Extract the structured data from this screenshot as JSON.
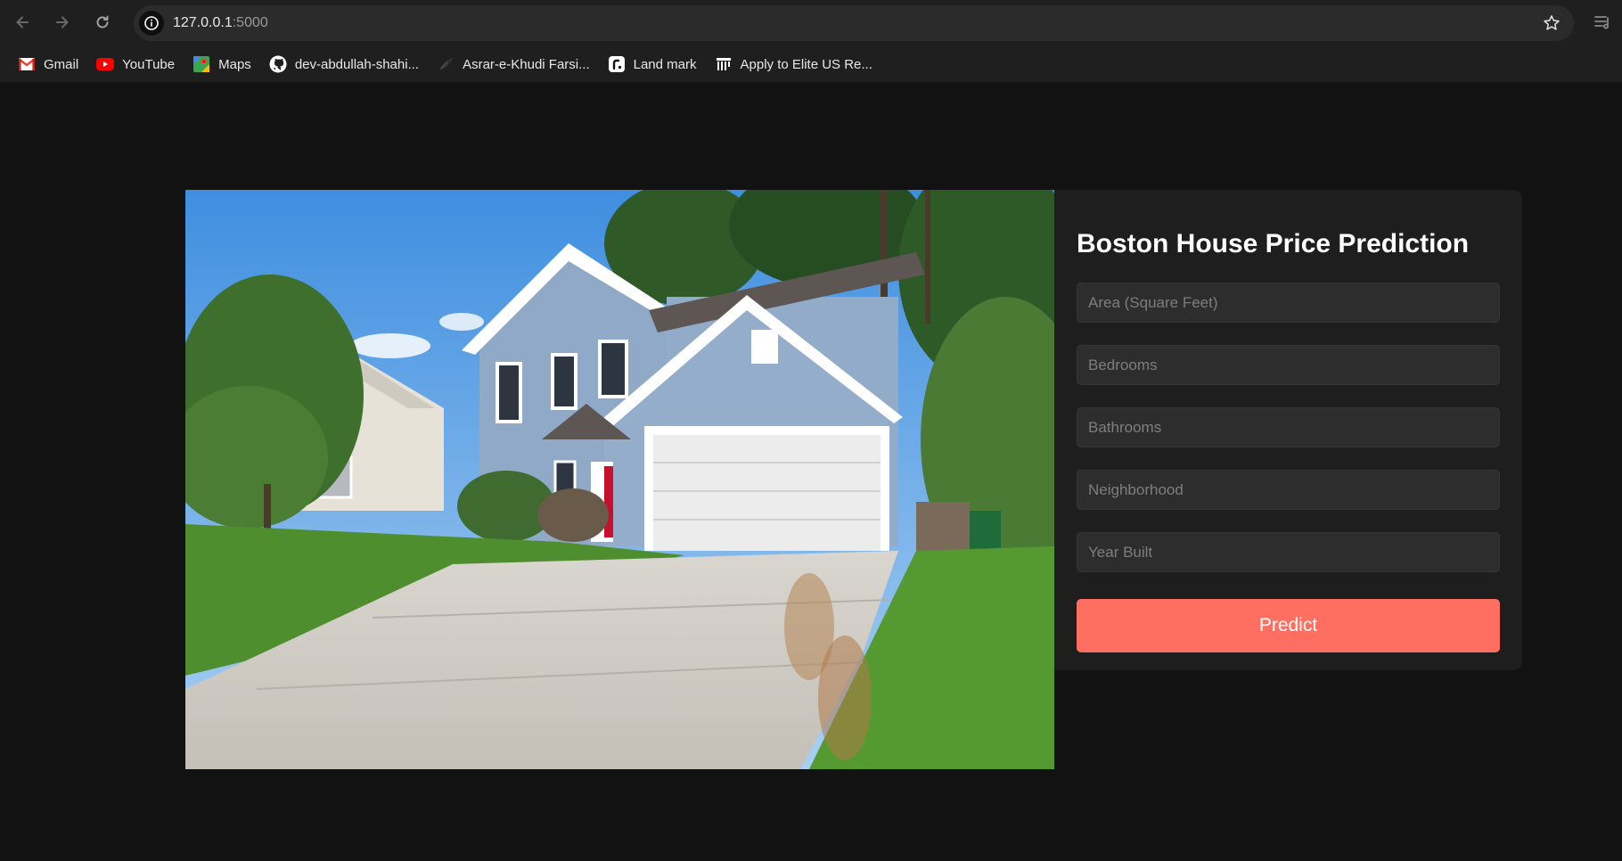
{
  "browser": {
    "url_host": "127.0.0.1",
    "url_port": ":5000",
    "bookmarks": [
      {
        "label": "Gmail",
        "icon": "gmail-icon"
      },
      {
        "label": "YouTube",
        "icon": "youtube-icon"
      },
      {
        "label": "Maps",
        "icon": "maps-icon"
      },
      {
        "label": "dev-abdullah-shahi...",
        "icon": "github-icon"
      },
      {
        "label": "Asrar-e-Khudi Farsi...",
        "icon": "bookmark-icon"
      },
      {
        "label": "Land mark",
        "icon": "landmark-icon"
      },
      {
        "label": "Apply to Elite US Re...",
        "icon": "bookmark-icon"
      }
    ]
  },
  "page": {
    "title": "Boston House Price Prediction",
    "fields": [
      {
        "name": "area-input",
        "placeholder": "Area (Square Feet)"
      },
      {
        "name": "bedrooms-input",
        "placeholder": "Bedrooms"
      },
      {
        "name": "bathrooms-input",
        "placeholder": "Bathrooms"
      },
      {
        "name": "neighborhood-input",
        "placeholder": "Neighborhood"
      },
      {
        "name": "year-built-input",
        "placeholder": "Year Built"
      }
    ],
    "predict_label": "Predict"
  },
  "colors": {
    "page_background": "#121212",
    "card_background": "#1e1e1e",
    "input_background": "#2d2d2d",
    "accent": "#ff6f61"
  }
}
